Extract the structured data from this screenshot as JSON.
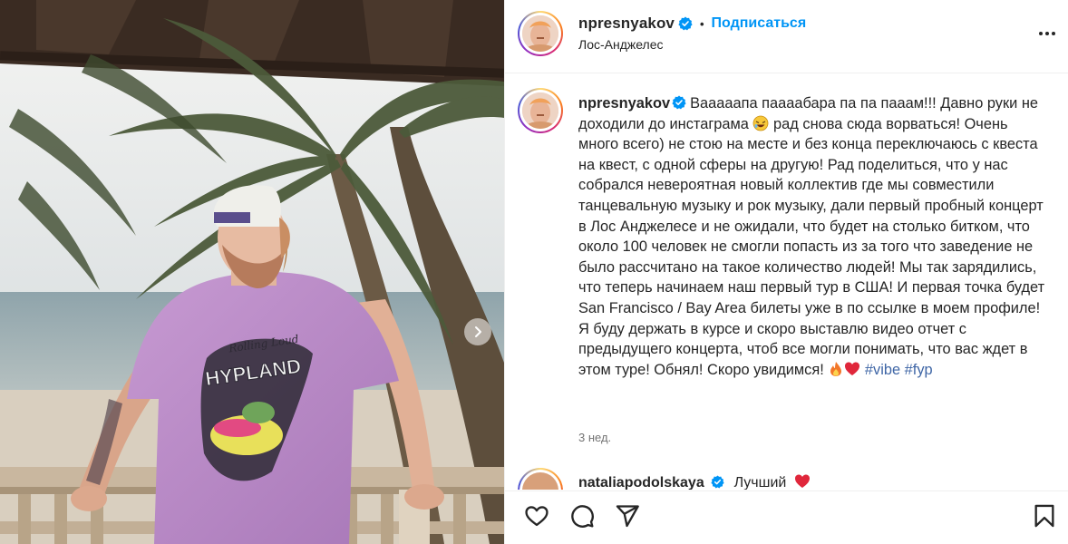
{
  "post": {
    "username": "npresnyakov",
    "follow_label": "Подписаться",
    "separator": "•",
    "location": "Лос-Анджелес",
    "more_label": "Дополнительно"
  },
  "caption": {
    "username": "npresnyakov",
    "part1": "Вааааапа паааабара па па пааам!!! Давно руки не доходили до инстаграма ",
    "part2": " рад снова сюда ворваться! Очень много всего) не стою на месте и без конца переключаюсь с квеста на квест, с одной сферы на другую! Рад поделиться, что у нас собрался невероятная новый коллектив где мы совместили танцевальную музыку и рок музыку, дали первый пробный концерт в Лос Анджелесе и не ожидали, что будет на столько битком, что около 100 человек не смогли попасть из за того что заведение не было рассчитано на такое количество людей! Мы так зарядились, что теперь начинаем наш первый тур в США! И первая точка будет San Francisco / Bay Area билеты уже в по ссылке в моем профиле! Я буду держать в курсе и скоро выставлю видео отчет с предыдущего концерта, чтоб все могли понимать, что вас ждет в этом туре! Обнял! Скоро увидимся! ",
    "hashtags": [
      "#vibe",
      "#fyp"
    ],
    "time_ago": "3 нед."
  },
  "comment": {
    "username": "nataliapodolskaya",
    "text": "Лучший"
  },
  "photo": {
    "shirt_print_top": "Rolling Loud",
    "shirt_print_main": "HYPLAND"
  },
  "icons": {
    "like": "heart-icon",
    "comment": "speech-bubble-icon",
    "share": "paper-plane-icon",
    "save": "bookmark-icon",
    "verified": "verified-badge-icon",
    "more": "ellipsis-icon",
    "next": "chevron-right-icon"
  },
  "colors": {
    "accent": "#0095f6",
    "hashtag": "#3f66a6",
    "muted": "#737373",
    "text": "#262626"
  }
}
